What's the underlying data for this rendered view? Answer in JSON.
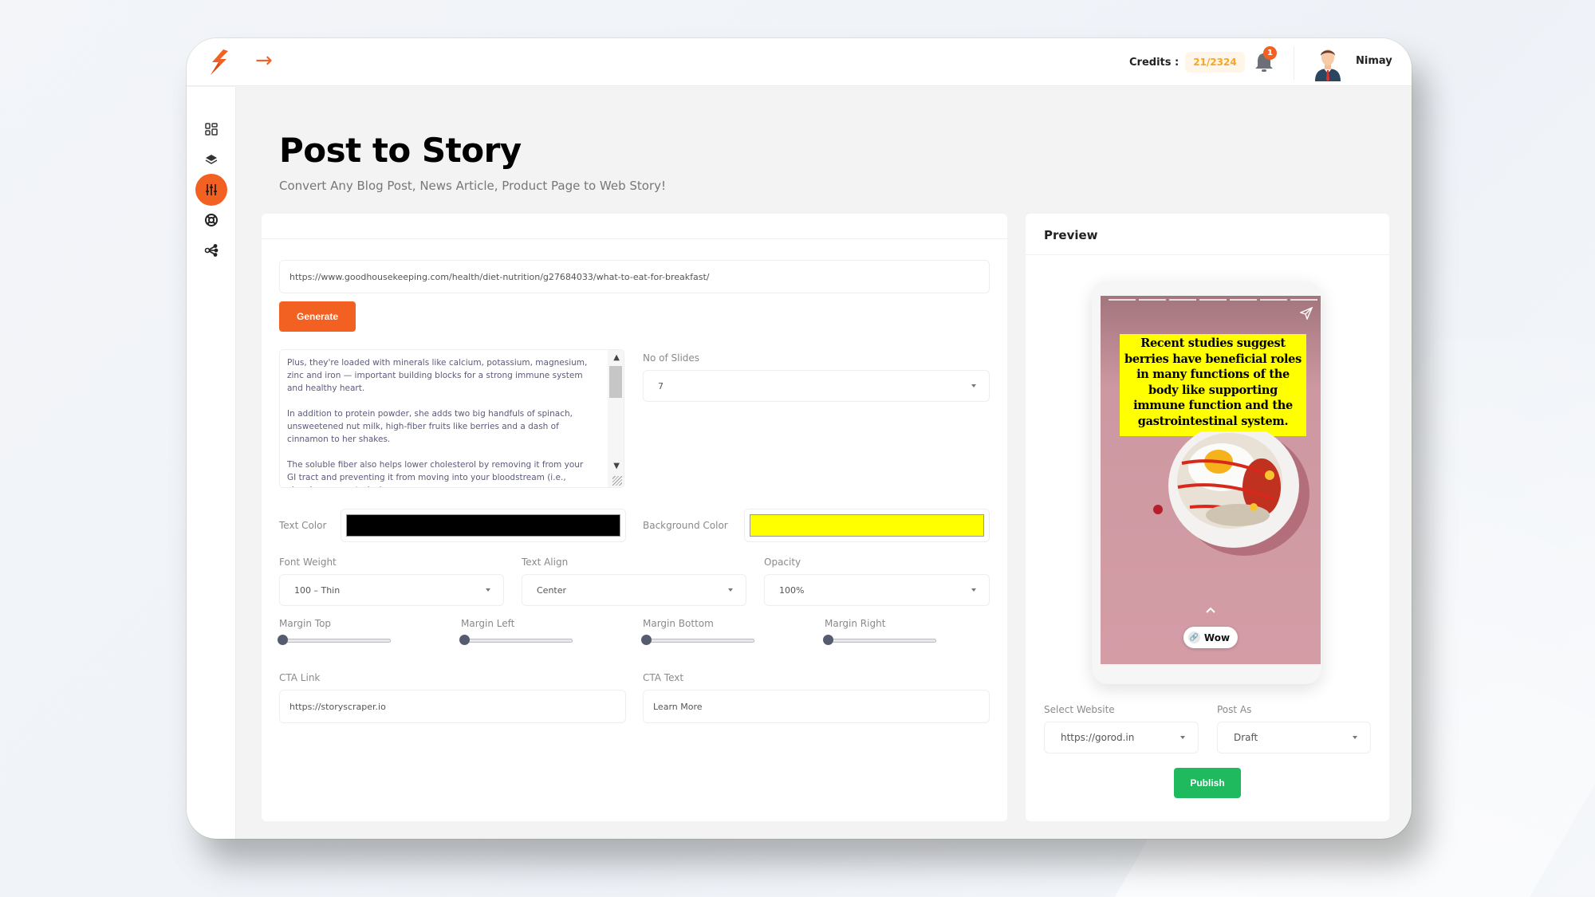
{
  "header": {
    "credits_label": "Credits :",
    "credits_value": "21/2324",
    "notification_count": "1",
    "username": "Nimay"
  },
  "sidebar": {
    "items": [
      {
        "icon": "dashboard-icon",
        "active": false
      },
      {
        "icon": "layers-icon",
        "active": false
      },
      {
        "icon": "sliders-icon",
        "active": true
      },
      {
        "icon": "lifebuoy-icon",
        "active": false
      },
      {
        "icon": "share-icon",
        "active": false
      }
    ]
  },
  "page": {
    "title": "Post to Story",
    "subtitle": "Convert Any Blog Post, News Article, Product Page to Web Story!"
  },
  "form": {
    "url_value": "https://www.goodhousekeeping.com/health/diet-nutrition/g27684033/what-to-eat-for-breakfast/",
    "generate_label": "Generate",
    "content_paragraphs": [
      "Plus, they're loaded with minerals like calcium, potassium, magnesium, zinc and iron — important building blocks for a strong immune system and healthy heart.",
      "In addition to protein powder, she adds two big handfuls of spinach, unsweetened nut milk, high-fiber fruits like berries and a dash of cinnamon to her shakes.",
      "The soluble fiber also helps lower cholesterol by removing it from your GI tract and preventing it from moving into your bloodstream (i.e., clogging your arteries)."
    ],
    "slides_label": "No of Slides",
    "slides_value": "7",
    "text_color_label": "Text Color",
    "text_color_value": "#000000",
    "bg_color_label": "Background Color",
    "bg_color_value": "#ffff00",
    "font_weight_label": "Font Weight",
    "font_weight_value": "100 – Thin",
    "text_align_label": "Text Align",
    "text_align_value": "Center",
    "opacity_label": "Opacity",
    "opacity_value": "100%",
    "margins": [
      {
        "label": "Margin Top",
        "value": 0
      },
      {
        "label": "Margin Left",
        "value": 0
      },
      {
        "label": "Margin Bottom",
        "value": 0
      },
      {
        "label": "Margin Right",
        "value": 0
      }
    ],
    "cta_link_label": "CTA Link",
    "cta_link_value": "https://storyscraper.io",
    "cta_text_label": "CTA Text",
    "cta_text_value": "Learn More"
  },
  "preview": {
    "title": "Preview",
    "slide_count": 7,
    "story_text": "Recent studies suggest berries have beneficial roles in many functions of the body like supporting immune function and the gastrointestinal system.",
    "cta_pill_label": "Wow",
    "select_website_label": "Select Website",
    "select_website_value": "https://gorod.in",
    "post_as_label": "Post As",
    "post_as_value": "Draft",
    "publish_label": "Publish"
  },
  "colors": {
    "accent": "#f26122",
    "publish_green": "#1fba5e",
    "credits_orange": "#f5a623"
  }
}
